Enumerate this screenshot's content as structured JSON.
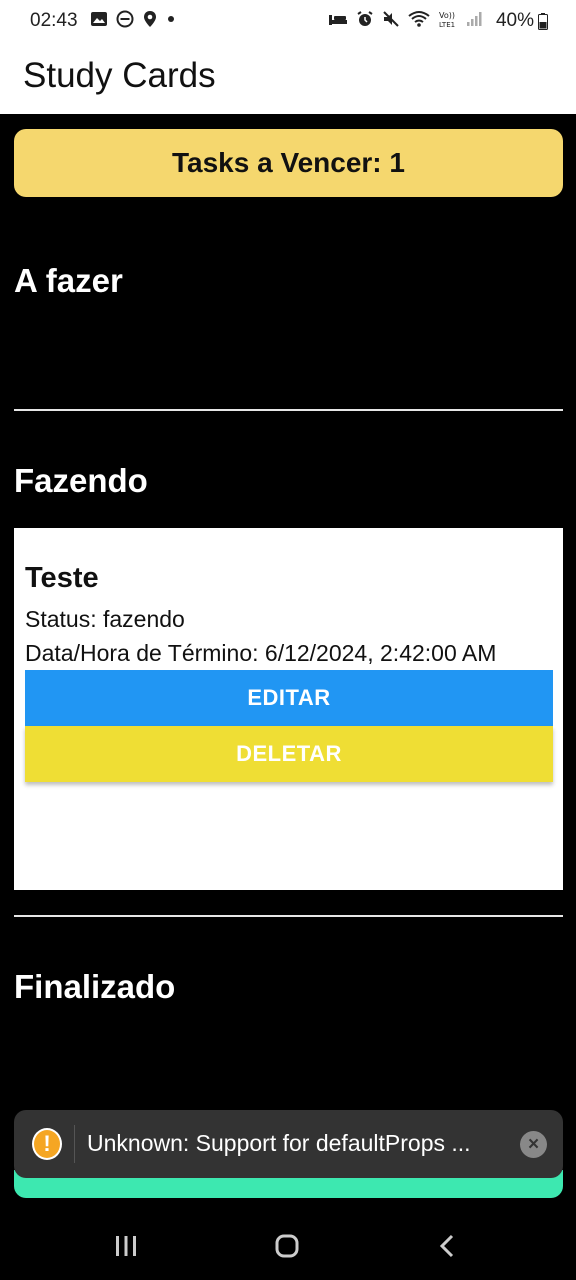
{
  "status_bar": {
    "time": "02:43",
    "battery": "40%",
    "left_icons": [
      "image-icon",
      "dnd-icon",
      "location-icon",
      "dot-icon"
    ],
    "right_icons": [
      "bed-icon",
      "alarm-icon",
      "mute-icon",
      "wifi-icon",
      "volte-icon",
      "signal-icon"
    ]
  },
  "app": {
    "title": "Study Cards"
  },
  "due_banner": {
    "label": "Tasks a Vencer: 1"
  },
  "sections": {
    "todo": {
      "title": "A fazer"
    },
    "doing": {
      "title": "Fazendo"
    },
    "done": {
      "title": "Finalizado"
    }
  },
  "task": {
    "title": "Teste",
    "status": "Status: fazendo",
    "deadline": "Data/Hora de Término: 6/12/2024, 2:42:00 AM",
    "edit_label": "EDITAR",
    "delete_label": "DELETAR"
  },
  "toast": {
    "icon": "!",
    "message": "Unknown: Support for defaultProps ...",
    "close": "×"
  },
  "colors": {
    "banner": "#f5d76e",
    "edit": "#2196f3",
    "delete": "#efde34",
    "toast_accent": "#3de8b0"
  },
  "nav_bar": {
    "icons": [
      "recents-icon",
      "home-icon",
      "back-icon"
    ]
  }
}
